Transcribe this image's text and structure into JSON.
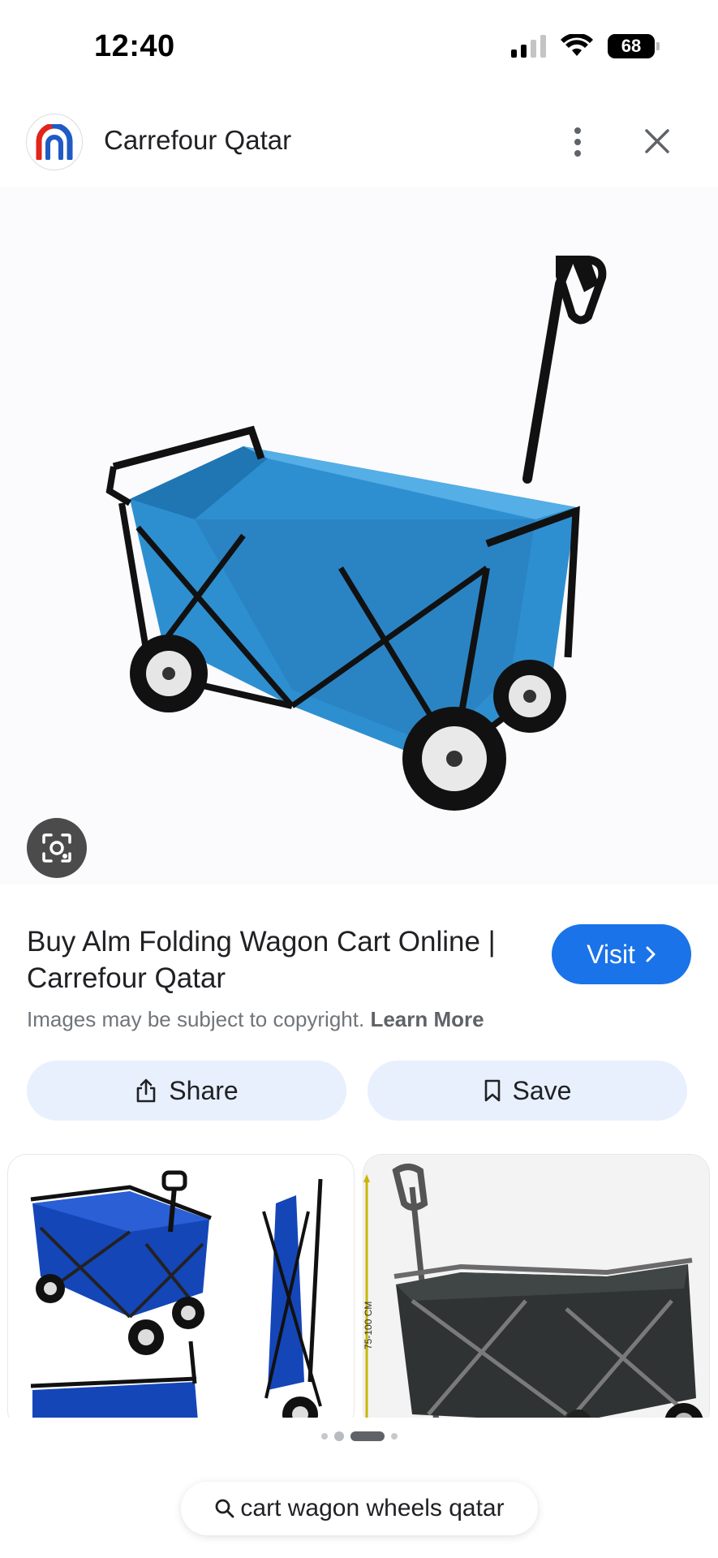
{
  "status": {
    "time": "12:40",
    "battery": "68",
    "icons": [
      "signal-icon",
      "wifi-icon",
      "battery-icon"
    ]
  },
  "header": {
    "site_name": "Carrefour Qatar",
    "logo_icon": "carrefour-logo",
    "more_icon": "more-vert-icon",
    "close_icon": "close-icon"
  },
  "result": {
    "title": "Buy Alm Folding Wagon Cart Online | Carrefour Qatar",
    "visit_label": "Visit",
    "copyright_text": "Images may be subject to copyright.",
    "learn_more": "Learn More"
  },
  "actions": {
    "share_label": "Share",
    "save_label": "Save"
  },
  "related": {
    "height_label": "75-100 CM"
  },
  "carousel": {
    "active_index": 2,
    "count": 4
  },
  "search": {
    "query": "cart wagon wheels qatar"
  },
  "colors": {
    "accent": "#1a73e8",
    "pill_bg": "#e8f0fe",
    "wagon_blue": "#2e8fd0",
    "carrefour_red": "#e1251b",
    "carrefour_blue": "#1e5bc6"
  }
}
